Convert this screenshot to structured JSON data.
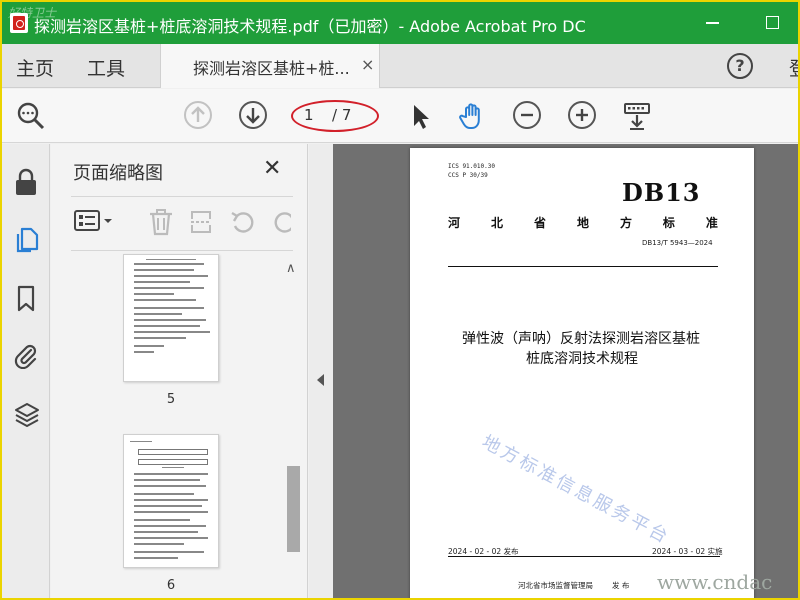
{
  "titlebar": {
    "title": "探测岩溶区基桩+桩底溶洞技术规程.pdf（已加密）- Adobe Acrobat Pro DC",
    "watermark": "好特卫士"
  },
  "menu": {
    "home": "主页",
    "tools": "工具",
    "tab_label": "探测岩溶区基桩+桩...",
    "tab_close": "×",
    "help": "?",
    "login": "登"
  },
  "toolbar": {
    "current_page": "1",
    "total_pages": "/ 7"
  },
  "thumbnails": {
    "title": "页面缩略图",
    "close": "✕",
    "pages": [
      {
        "number": "5"
      },
      {
        "number": "6"
      }
    ]
  },
  "document": {
    "ics": "ICS  91.010.30",
    "ccs": "CCS  P 30/39",
    "db_mark": "DB13",
    "std_title_chars": [
      "河",
      "北",
      "省",
      "地",
      "方",
      "标",
      "准"
    ],
    "std_number": "DB13/T 5943—2024",
    "title_line1": "弹性波（声呐）反射法探测岩溶区基桩",
    "title_line2": "桩底溶洞技术规程",
    "watermark": "地方标准信息服务平台",
    "publish_date": "2024 - 02 - 02 发布",
    "effective_date": "2024 - 03 - 02 实施",
    "issuer": "河北省市场监督管理局",
    "issue_word": "发  布"
  },
  "site_watermark": "www.cndac",
  "colors": {
    "titlebar": "#1f9e3a",
    "frame": "#ebd400",
    "highlight_ellipse": "#d2202a",
    "active_rail_icon": "#2a7fd4",
    "doc_background": "#707070"
  }
}
